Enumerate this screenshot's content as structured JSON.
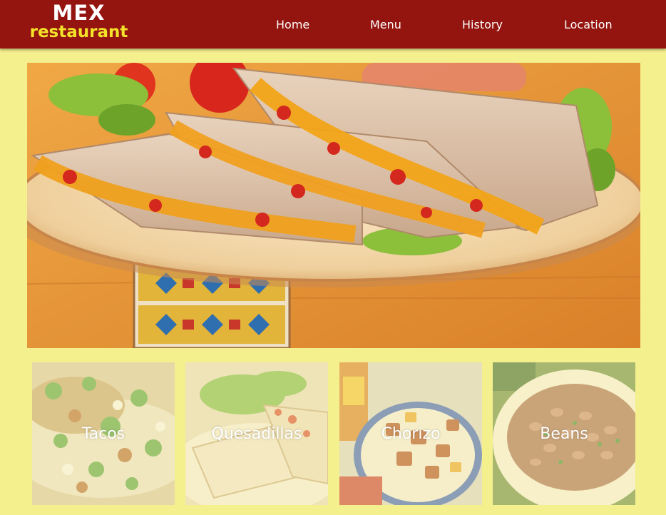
{
  "brand": {
    "line1": "MEX",
    "line2": "restaurant"
  },
  "nav": {
    "home": "Home",
    "menu": "Menu",
    "history": "History",
    "location": "Location"
  },
  "hero": {
    "image": "quesadilla-plate-photo"
  },
  "dishes": [
    {
      "label": "Tacos",
      "image": "tacos-photo"
    },
    {
      "label": "Quesadillas",
      "image": "quesadillas-photo"
    },
    {
      "label": "Chorizo",
      "image": "chorizo-photo"
    },
    {
      "label": "Beans",
      "image": "beans-photo"
    }
  ],
  "colors": {
    "header": "#94140f",
    "background": "#f5f08e",
    "brand_accent": "#f3e22a",
    "nav_text": "#ffffff"
  }
}
